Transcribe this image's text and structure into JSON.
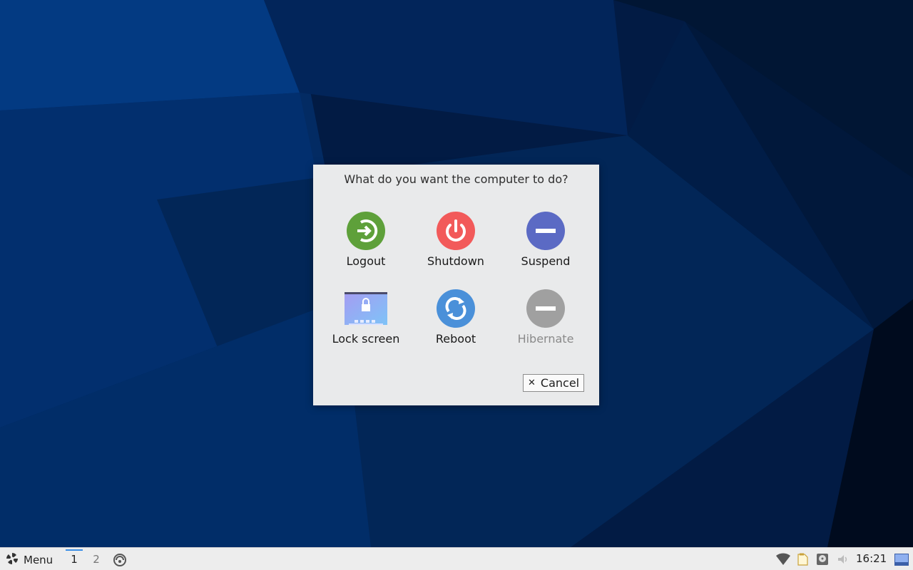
{
  "dialog": {
    "title": "What do you want the computer to do?",
    "actions": [
      {
        "label": "Logout",
        "icon": "logout-icon",
        "color": "#5ea03a",
        "enabled": true
      },
      {
        "label": "Shutdown",
        "icon": "power-icon",
        "color": "#f25a5a",
        "enabled": true
      },
      {
        "label": "Suspend",
        "icon": "suspend-icon",
        "color": "#5b6ac4",
        "enabled": true
      },
      {
        "label": "Lock screen",
        "icon": "lock-screen-icon",
        "color": "#8aa9f5",
        "enabled": true
      },
      {
        "label": "Reboot",
        "icon": "reboot-icon",
        "color": "#4a90d9",
        "enabled": true
      },
      {
        "label": "Hibernate",
        "icon": "hibernate-icon",
        "color": "#a0a0a0",
        "enabled": false
      }
    ],
    "cancel_label": "Cancel"
  },
  "taskbar": {
    "menu_label": "Menu",
    "workspaces": [
      "1",
      "2"
    ],
    "active_workspace": "1",
    "clock": "16:21",
    "tray_icons": [
      "wifi-icon",
      "clipboard-icon",
      "disk-icon",
      "volume-icon",
      "desktop-icon"
    ]
  },
  "colors": {
    "desktop_background": "#02204f",
    "dialog_background": "#e9eaeb",
    "taskbar_background": "#ededed",
    "workspace_accent": "#3a8ee6"
  }
}
